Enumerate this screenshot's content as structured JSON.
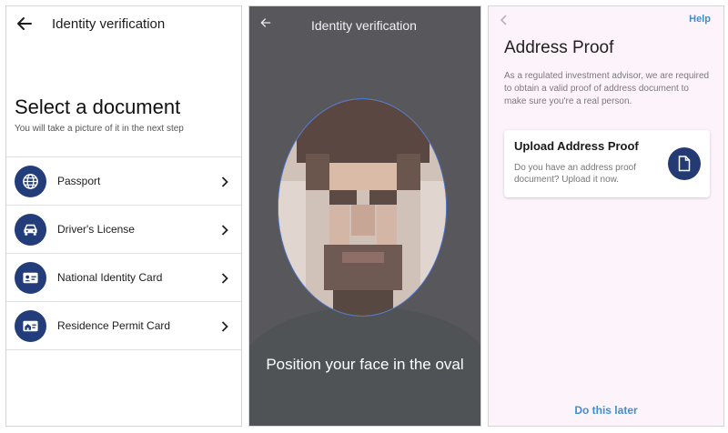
{
  "screen1": {
    "title": "Identity verification",
    "heading": "Select a document",
    "subheading": "You will take a picture of it in the next step",
    "documents": [
      {
        "label": "Passport",
        "icon": "globe-icon"
      },
      {
        "label": "Driver's License",
        "icon": "car-icon"
      },
      {
        "label": "National Identity Card",
        "icon": "id-card-icon"
      },
      {
        "label": "Residence Permit Card",
        "icon": "residence-card-icon"
      }
    ]
  },
  "screen2": {
    "title": "Identity verification",
    "instruction": "Position your face in the oval"
  },
  "screen3": {
    "help_label": "Help",
    "heading": "Address Proof",
    "description": "As a regulated investment advisor, we are required to obtain a valid proof of address document to make sure you're a real person.",
    "card_title": "Upload Address Proof",
    "card_description": "Do you have an address proof document? Upload it now.",
    "later_label": "Do this later"
  },
  "colors": {
    "accent_navy": "#223d7a",
    "link_blue": "#3f8fd0",
    "camera_bg": "#58585c",
    "oval_border": "#4a78d4",
    "screen3_bg": "#fdf3fb"
  }
}
